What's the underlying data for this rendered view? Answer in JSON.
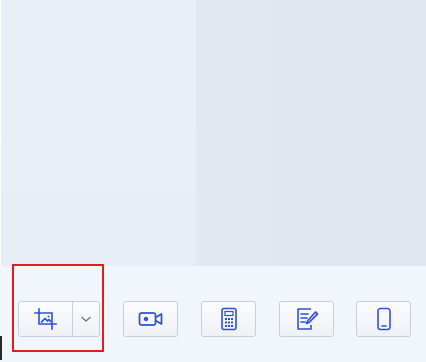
{
  "window": {
    "title": ""
  },
  "toolbar": {
    "buttons": [
      {
        "id": "screenshot",
        "icon": "crop-image-icon",
        "has_dropdown": true,
        "dropdown_icon": "chevron-down-icon"
      },
      {
        "id": "record",
        "icon": "video-camera-icon"
      },
      {
        "id": "calculator",
        "icon": "calculator-icon"
      },
      {
        "id": "notes",
        "icon": "note-edit-icon"
      },
      {
        "id": "phone",
        "icon": "mobile-phone-icon"
      }
    ]
  },
  "colors": {
    "icon": "#2f4fd8",
    "highlight": "#e01e1e",
    "toolbar_bg": "#f1f6fd",
    "left_pane_bg": "#eaeff7",
    "right_pane_bg": "#e2e7ef"
  }
}
